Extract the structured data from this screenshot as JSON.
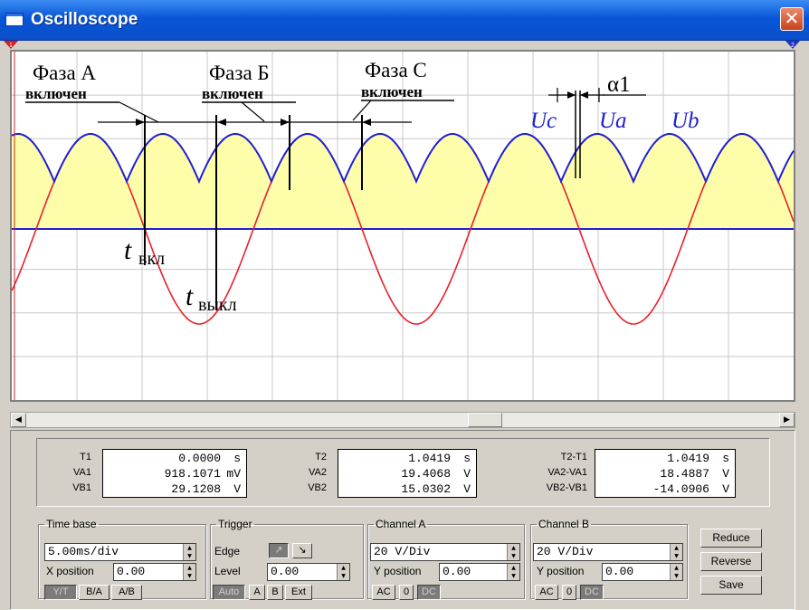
{
  "window": {
    "title": "Oscilloscope",
    "close_glyph": "✕"
  },
  "annotations": {
    "phase_a": "Фаза А",
    "phase_b": "Фаза Б",
    "phase_c": "Фаза С",
    "switched_on": "включен",
    "alpha": "α1",
    "uc": "Uc",
    "ua": "Ua",
    "ub": "Ub",
    "t_on_main": "t",
    "t_on_sub": "вкл",
    "t_off_main": "t",
    "t_off_sub": "выкл"
  },
  "markers": {
    "t1": "1",
    "t2": "2"
  },
  "colors": {
    "screen_bg": "#ffffff",
    "fill": "#fdfdaa",
    "channel_a": "#e8202a",
    "channel_b": "#2020d0",
    "grid": "#c8c8c8",
    "marker_t1": "#d02020",
    "marker_t2": "#2030c0"
  },
  "readouts": {
    "t1": {
      "label_t": "T1",
      "label_va": "VA1",
      "label_vb": "VB1",
      "t": "0.0000",
      "t_unit": "s",
      "va": "918.1071",
      "va_unit": "mV",
      "vb": "29.1208",
      "vb_unit": "V"
    },
    "t2": {
      "label_t": "T2",
      "label_va": "VA2",
      "label_vb": "VB2",
      "t": "1.0419",
      "t_unit": "s",
      "va": "19.4068",
      "va_unit": "V",
      "vb": "15.0302",
      "vb_unit": "V"
    },
    "diff": {
      "label_t": "T2-T1",
      "label_va": "VA2-VA1",
      "label_vb": "VB2-VB1",
      "t": "1.0419",
      "t_unit": "s",
      "va": "18.4887",
      "va_unit": "V",
      "vb": "-14.0906",
      "vb_unit": "V"
    }
  },
  "timebase": {
    "legend": "Time base",
    "value": "5.00ms/div",
    "xpos_label": "X position",
    "xpos": "0.00",
    "yt": "Y/T",
    "ba": "B/A",
    "ab": "A/B"
  },
  "trigger": {
    "legend": "Trigger",
    "edge_label": "Edge",
    "edge_rise": "↗",
    "edge_fall": "↘",
    "level_label": "Level",
    "level": "0.00",
    "auto": "Auto",
    "a": "A",
    "b": "B",
    "ext": "Ext"
  },
  "channel_a": {
    "legend": "Channel A",
    "scale": "20 V/Div",
    "ypos_label": "Y position",
    "ypos": "0.00",
    "ac": "AC",
    "zero": "0",
    "dc": "DC"
  },
  "channel_b": {
    "legend": "Channel B",
    "scale": "20 V/Div",
    "ypos_label": "Y position",
    "ypos": "0.00",
    "ac": "AC",
    "zero": "0",
    "dc": "DC"
  },
  "actions": {
    "reduce": "Reduce",
    "reverse": "Reverse",
    "save": "Save"
  }
}
